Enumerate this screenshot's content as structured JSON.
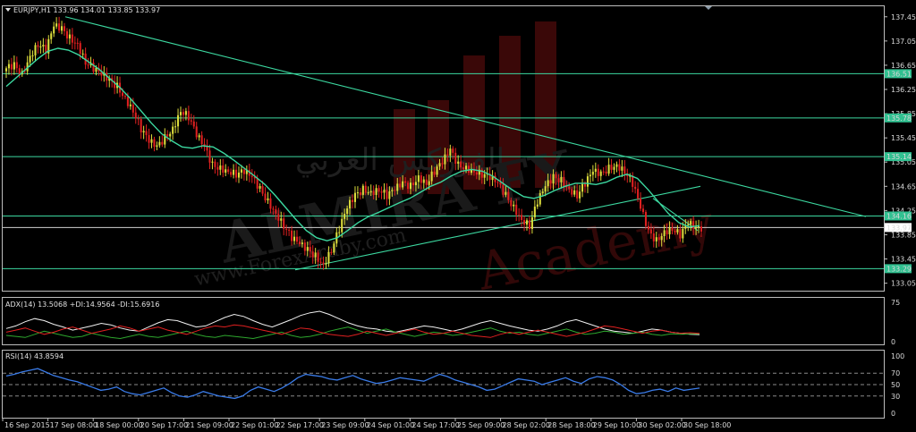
{
  "header": {
    "symbol_line": "EURJPY,H1  133.96 134.01 133.85 133.97"
  },
  "watermark": {
    "arabic": "الفوركس العربي",
    "brand": "ALMIRA FX",
    "url": "www.ForexArdby.com",
    "academy": "Academy"
  },
  "colors": {
    "background": "#000000",
    "grid_panel_border": "#c8c8c8",
    "bull": "#dcdc3c",
    "bear": "#e02020",
    "ma": "#3cd8a0",
    "hline": "#3cd8a0",
    "trend": "#3cd8a0",
    "adx": "#f0f0f0",
    "plus_di": "#2ea82e",
    "minus_di": "#e02020",
    "rsi": "#3a7be8",
    "level_label_bg": "#30c090"
  },
  "chart_data": [
    {
      "type": "candlestick",
      "title": "EURJPY,H1 133.96 134.01 133.85 133.97",
      "ylim": [
        133.0,
        137.55
      ],
      "yticks": [
        "137.45",
        "137.05",
        "136.65",
        "136.25",
        "135.85",
        "135.45",
        "135.05",
        "134.65",
        "134.25",
        "133.85",
        "133.45",
        "133.05"
      ],
      "levels": [
        "136.51",
        "135.78",
        "135.14",
        "134.16",
        "133.97",
        "133.29"
      ],
      "level_values": [
        136.51,
        135.78,
        135.14,
        134.16,
        133.97,
        133.29
      ],
      "xticks": [
        "16 Sep 2015",
        "17 Sep 08:00",
        "18 Sep 00:00",
        "20 Sep 17:00",
        "21 Sep 09:00",
        "22 Sep 01:00",
        "22 Sep 17:00",
        "23 Sep 09:00",
        "24 Sep 01:00",
        "24 Sep 17:00",
        "25 Sep 09:00",
        "28 Sep 02:00",
        "28 Sep 18:00",
        "29 Sep 10:00",
        "30 Sep 02:00",
        "30 Sep 18:00"
      ],
      "close_path": [
        136.6,
        136.65,
        136.5,
        136.8,
        137.0,
        136.9,
        137.3,
        137.25,
        137.1,
        137.0,
        136.7,
        136.6,
        136.5,
        136.4,
        136.3,
        136.1,
        135.9,
        135.6,
        135.4,
        135.3,
        135.45,
        135.6,
        135.9,
        135.8,
        135.5,
        135.3,
        135.0,
        134.95,
        134.9,
        134.85,
        134.9,
        134.8,
        134.6,
        134.4,
        134.2,
        134.0,
        133.8,
        133.7,
        133.6,
        133.5,
        133.35,
        133.6,
        133.95,
        134.3,
        134.5,
        134.6,
        134.55,
        134.6,
        134.5,
        134.6,
        134.7,
        134.65,
        134.8,
        134.7,
        134.9,
        135.05,
        135.25,
        135.0,
        134.95,
        134.9,
        134.85,
        134.8,
        134.7,
        134.5,
        134.3,
        134.1,
        134.0,
        134.4,
        134.65,
        134.8,
        134.75,
        134.6,
        134.5,
        134.7,
        134.9,
        134.85,
        134.95,
        135.0,
        134.9,
        134.7,
        134.3,
        133.9,
        133.75,
        133.9,
        133.95,
        133.85,
        134.05,
        133.95,
        133.97
      ],
      "ma_path": [
        136.3,
        136.45,
        136.6,
        136.75,
        136.88,
        136.93,
        136.9,
        136.82,
        136.7,
        136.58,
        136.43,
        136.28,
        136.1,
        135.9,
        135.7,
        135.52,
        135.4,
        135.3,
        135.28,
        135.32,
        135.3,
        135.2,
        135.08,
        134.95,
        134.82,
        134.68,
        134.5,
        134.3,
        134.1,
        133.92,
        133.8,
        133.75,
        133.8,
        133.92,
        134.05,
        134.15,
        134.22,
        134.3,
        134.38,
        134.45,
        134.55,
        134.65,
        134.72,
        134.82,
        134.9,
        134.93,
        134.9,
        134.82,
        134.7,
        134.58,
        134.48,
        134.45,
        134.5,
        134.58,
        134.65,
        134.7,
        134.7,
        134.68,
        134.72,
        134.8,
        134.85,
        134.78,
        134.6,
        134.4,
        134.2,
        134.05,
        133.98,
        134.0
      ]
    },
    {
      "type": "line",
      "title": "ADX(14) 13.5068 +DI:14.9564 -DI:15.6916",
      "ylim": [
        0,
        75
      ],
      "yticks": [
        "75",
        "0"
      ],
      "series": [
        {
          "name": "ADX",
          "values": [
            25,
            30,
            38,
            44,
            40,
            33,
            28,
            22,
            26,
            30,
            35,
            32,
            26,
            22,
            20,
            28,
            36,
            42,
            40,
            34,
            28,
            30,
            38,
            46,
            52,
            48,
            40,
            33,
            28,
            35,
            42,
            50,
            55,
            58,
            52,
            44,
            36,
            30,
            26,
            24,
            20,
            18,
            22,
            26,
            30,
            28,
            24,
            20,
            24,
            30,
            36,
            40,
            35,
            30,
            26,
            22,
            20,
            24,
            30,
            38,
            42,
            36,
            30,
            24,
            20,
            18,
            16,
            20,
            24,
            22,
            18,
            16,
            14,
            13.5
          ]
        },
        {
          "name": "+DI",
          "values": [
            12,
            10,
            8,
            14,
            20,
            16,
            12,
            8,
            10,
            16,
            12,
            8,
            6,
            10,
            14,
            10,
            8,
            12,
            16,
            20,
            14,
            10,
            8,
            12,
            10,
            8,
            6,
            10,
            14,
            18,
            12,
            8,
            10,
            14,
            20,
            24,
            28,
            22,
            16,
            20,
            24,
            18,
            14,
            10,
            14,
            18,
            16,
            12,
            14,
            18,
            22,
            26,
            20,
            16,
            18,
            14,
            12,
            16,
            20,
            24,
            18,
            14,
            16,
            20,
            18,
            14,
            16,
            18,
            14,
            12,
            15,
            14,
            15,
            14.96
          ]
        },
        {
          "name": "-DI",
          "values": [
            18,
            22,
            26,
            20,
            14,
            18,
            24,
            28,
            22,
            16,
            20,
            24,
            30,
            26,
            20,
            24,
            28,
            22,
            18,
            14,
            20,
            26,
            30,
            28,
            32,
            30,
            26,
            22,
            18,
            14,
            20,
            26,
            24,
            18,
            14,
            12,
            10,
            14,
            20,
            16,
            12,
            16,
            20,
            24,
            18,
            14,
            16,
            20,
            16,
            12,
            10,
            8,
            14,
            18,
            14,
            18,
            22,
            18,
            14,
            10,
            14,
            18,
            24,
            30,
            28,
            24,
            20,
            16,
            20,
            22,
            18,
            16,
            17,
            15.69
          ]
        }
      ]
    },
    {
      "type": "line",
      "title": "RSI(14) 43.8594",
      "ylim": [
        0,
        100
      ],
      "yticks": [
        "100",
        "70",
        "50",
        "30",
        "0"
      ],
      "series": [
        {
          "name": "RSI",
          "values": [
            65,
            68,
            72,
            75,
            78,
            72,
            66,
            62,
            58,
            55,
            50,
            45,
            40,
            42,
            46,
            38,
            34,
            32,
            36,
            40,
            44,
            36,
            30,
            28,
            32,
            38,
            34,
            30,
            28,
            26,
            30,
            40,
            46,
            42,
            38,
            44,
            52,
            62,
            68,
            66,
            64,
            60,
            58,
            62,
            66,
            60,
            56,
            52,
            54,
            58,
            62,
            60,
            58,
            56,
            62,
            68,
            64,
            58,
            54,
            50,
            46,
            40,
            42,
            48,
            54,
            60,
            58,
            56,
            50,
            54,
            58,
            62,
            56,
            52,
            60,
            64,
            62,
            58,
            50,
            40,
            34,
            36,
            40,
            42,
            38,
            44,
            40,
            42,
            43.86
          ]
        }
      ]
    }
  ]
}
